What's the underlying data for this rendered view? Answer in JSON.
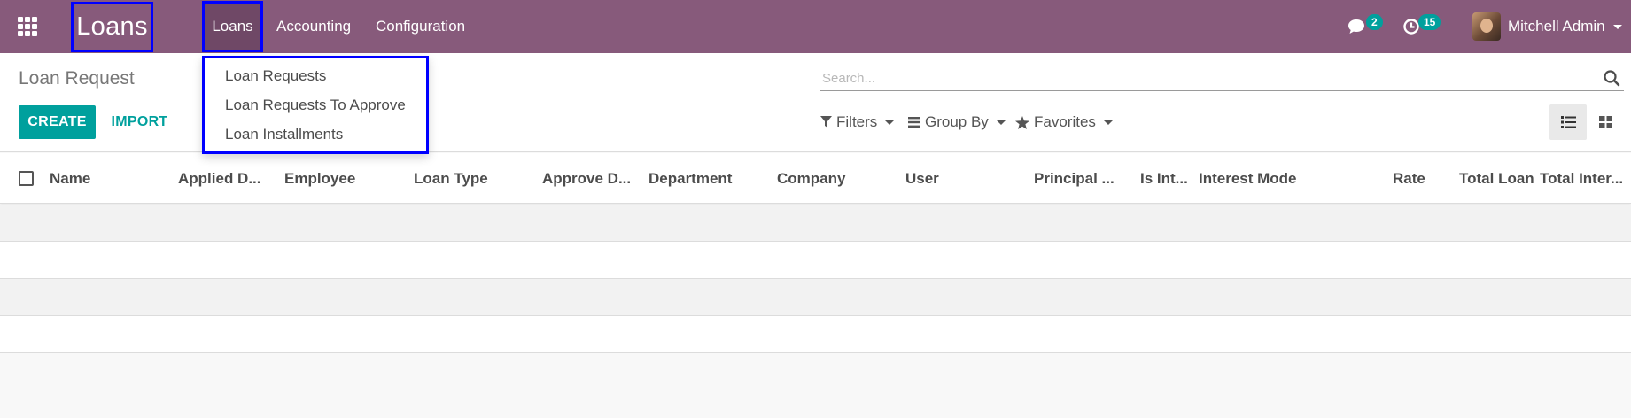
{
  "navbar": {
    "brand": "Loans",
    "menus": [
      {
        "label": "Loans"
      },
      {
        "label": "Accounting"
      },
      {
        "label": "Configuration"
      }
    ],
    "messages_count": "2",
    "activities_count": "15",
    "user_name": "Mitchell Admin"
  },
  "dropdown": {
    "items": [
      {
        "label": "Loan Requests"
      },
      {
        "label": "Loan Requests To Approve"
      },
      {
        "label": "Loan Installments"
      }
    ]
  },
  "control_panel": {
    "title": "Loan Request",
    "create_label": "CREATE",
    "import_label": "IMPORT",
    "search_placeholder": "Search...",
    "filters_label": "Filters",
    "group_by_label": "Group By",
    "favorites_label": "Favorites"
  },
  "table": {
    "columns": [
      "Name",
      "Applied D...",
      "Employee",
      "Loan Type",
      "Approve D...",
      "Department",
      "Company",
      "User",
      "Principal ...",
      "Is Int...",
      "Interest Mode",
      "Rate",
      "Total Loan",
      "Total Inter..."
    ],
    "rows": []
  },
  "colors": {
    "navbar": "#875a7b",
    "accent": "#00a09d",
    "highlight_border": "#0000ff"
  }
}
